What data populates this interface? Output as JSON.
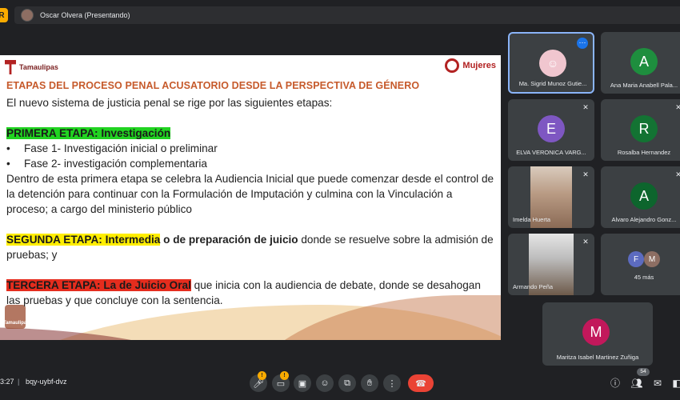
{
  "topbar": {
    "presenter_label": "Oscar Olvera (Presentando)"
  },
  "slide": {
    "logo_left": "Tamaulipas",
    "logo_right": "Mujeres",
    "seal_label": "Tamaulipas",
    "title": "ETAPAS DEL PROCESO PENAL ACUSATORIO DESDE LA PERSPECTIVA DE GÉNERO",
    "intro": "El nuevo sistema de justicia penal se rige por las siguientes etapas:",
    "stage1_heading": "PRIMERA ETAPA: Investigación",
    "bullet1": "Fase 1- Investigación inicial o preliminar",
    "bullet2": "Fase 2- investigación complementaria",
    "stage1_text": "Dentro de esta primera etapa se celebra la Audiencia Inicial que puede comenzar desde el control de la detención para continuar con la Formulación de Imputación y culmina con la Vinculación a proceso; a cargo del ministerio público",
    "stage2_heading": "SEGUNDA ETAPA: Intermedia",
    "stage2_bold": " o de preparación de juicio",
    "stage2_text": " donde se resuelve sobre la admisión de pruebas; y",
    "stage3_heading": "TERCERA ETAPA: La de Juicio Oral",
    "stage3_text": " que inicia con la audiencia de debate, donde se desahogan las pruebas y que concluye con la sentencia."
  },
  "participants": [
    {
      "name": "Ma. Sigrid Munoz Gutie...",
      "initial": "",
      "color": "#f0c6cf"
    },
    {
      "name": "Ana Maria Anabell Pala...",
      "initial": "A",
      "color": "#1e8e3e"
    },
    {
      "name": "ELVA VERONICA VARG...",
      "initial": "E",
      "color": "#7e57c2"
    },
    {
      "name": "Rosalba Hernandez",
      "initial": "R",
      "color": "#137333"
    },
    {
      "name": "Imelda Huerta",
      "initial": "",
      "color": ""
    },
    {
      "name": "Alvaro Alejandro Gonz...",
      "initial": "A",
      "color": "#0d652d"
    },
    {
      "name": "Armando Peña",
      "initial": "",
      "color": ""
    },
    {
      "name": "45 más",
      "initial": "",
      "color": ""
    },
    {
      "name": "Maritza Isabel Martinez Zuñiga",
      "initial": "M",
      "color": "#c2185b"
    }
  ],
  "others": {
    "initial1": "F",
    "color1": "#5c6bc0",
    "initial2": "M",
    "color2": "#8d6e63"
  },
  "bottombar": {
    "time": "3:27",
    "separator": "|",
    "meeting_code": "bqy-uybf-dvz",
    "mic_badge": "!",
    "cam_badge": "!",
    "people_count": "54"
  },
  "icons": [
    "mic-icon",
    "camera-icon",
    "captions-icon",
    "emoji-icon",
    "present-icon",
    "raise-hand-icon",
    "more-icon",
    "hangup-icon",
    "info-icon",
    "people-icon",
    "chat-icon",
    "activities-icon"
  ]
}
